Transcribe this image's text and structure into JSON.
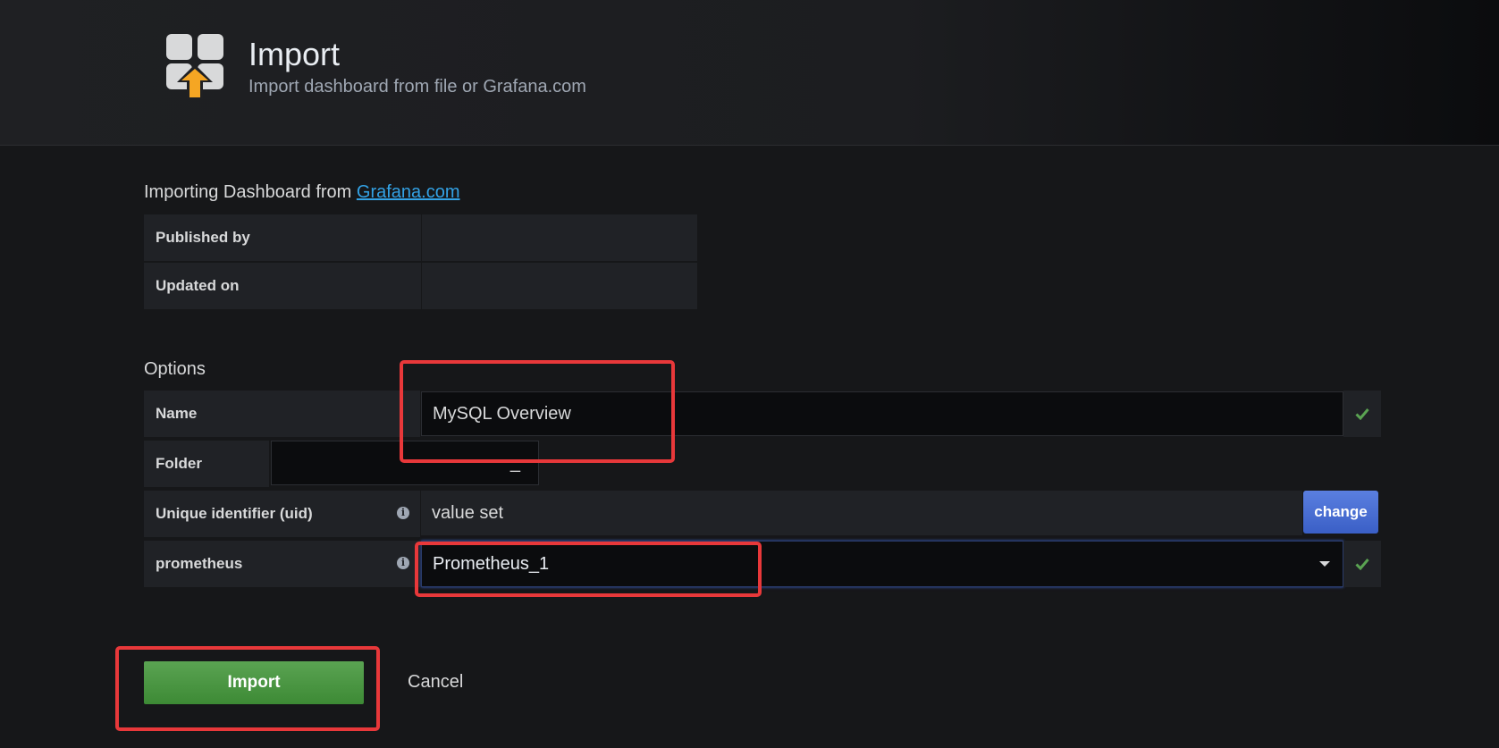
{
  "header": {
    "title": "Import",
    "subtitle": "Import dashboard from file or Grafana.com",
    "icon": "dashboard-import-icon"
  },
  "importing": {
    "prefix": "Importing Dashboard from ",
    "link_text": "Grafana.com"
  },
  "info_rows": [
    {
      "label": "Published by",
      "value": ""
    },
    {
      "label": "Updated on",
      "value": ""
    }
  ],
  "options": {
    "title": "Options",
    "name": {
      "label": "Name",
      "value": "MySQL Overview"
    },
    "folder": {
      "label": "Folder",
      "value": "_"
    },
    "uid": {
      "label": "Unique identifier (uid)",
      "value": "value set",
      "change_label": "change"
    },
    "prometheus": {
      "label": "prometheus",
      "value": "Prometheus_1"
    }
  },
  "actions": {
    "import_label": "Import",
    "cancel_label": "Cancel"
  },
  "colors": {
    "background": "#161719",
    "link": "#33a2e5",
    "success": "#5aa352",
    "primary": "#3a5fc6",
    "annotation": "#e8383a"
  }
}
